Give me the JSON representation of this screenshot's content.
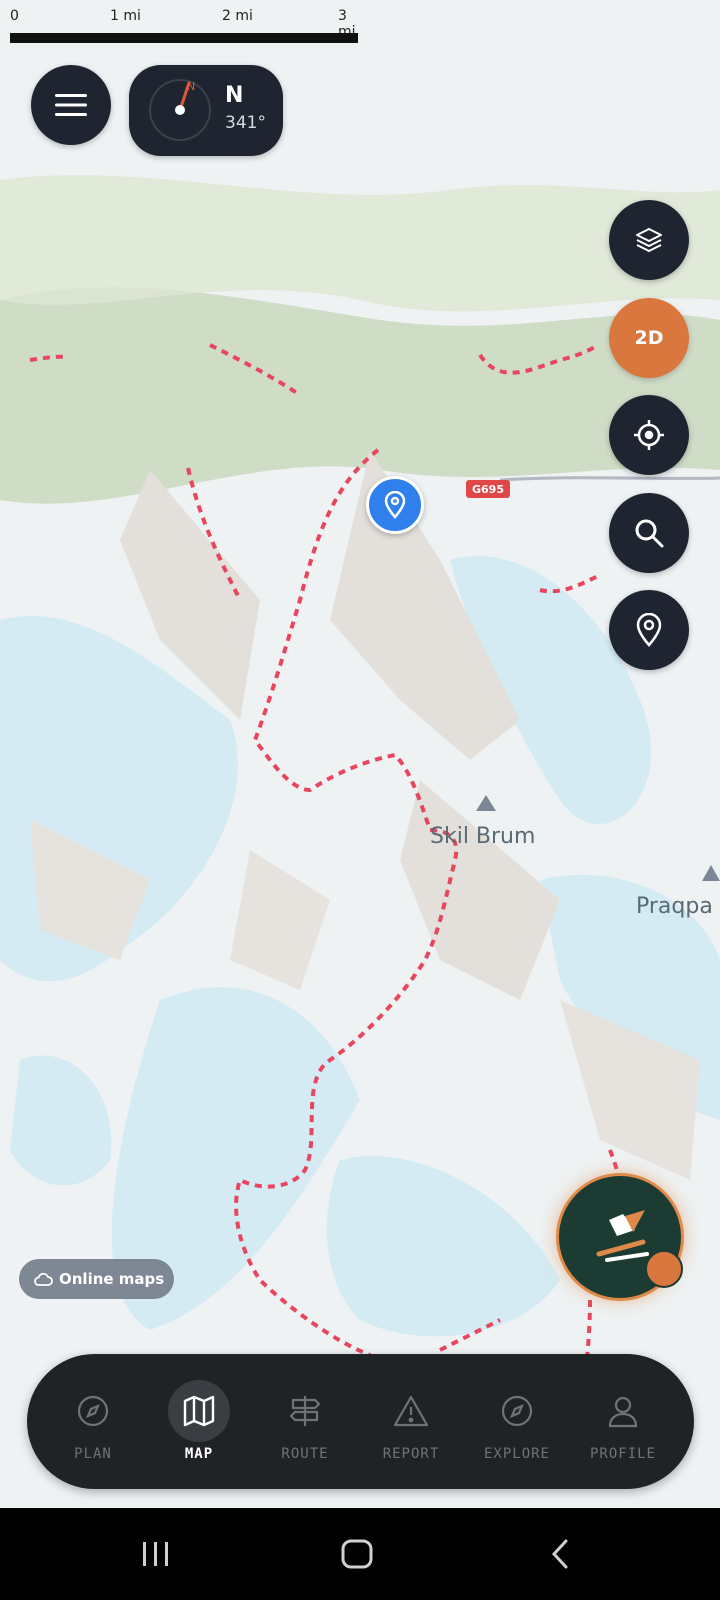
{
  "scale_bar": {
    "labels": [
      "0",
      "1 mi",
      "2 mi",
      "3 mi"
    ]
  },
  "top": {
    "menu_icon": "hamburger-icon",
    "compass": {
      "direction": "N",
      "degrees": "341°"
    }
  },
  "side_controls": {
    "layers_icon": "layers-icon",
    "mode_label": "2D",
    "locate_icon": "crosshair-icon",
    "search_icon": "search-icon",
    "pin_icon": "map-pin-icon"
  },
  "map": {
    "labels": [
      "Skil Brum",
      "Praqpa"
    ],
    "road_badge": "G695",
    "colors": {
      "glacier": "#d4ebf3",
      "forest": "#c9d8bd",
      "trail": "#e8455e",
      "rock": "#e6e3df"
    }
  },
  "online_maps": {
    "label": "Online maps",
    "icon": "cloud-icon"
  },
  "bottom_nav": {
    "items": [
      {
        "label": "PLAN",
        "icon": "compass-icon",
        "active": false
      },
      {
        "label": "MAP",
        "icon": "map-icon",
        "active": true
      },
      {
        "label": "ROUTE",
        "icon": "signpost-icon",
        "active": false
      },
      {
        "label": "REPORT",
        "icon": "warning-icon",
        "active": false
      },
      {
        "label": "EXPLORE",
        "icon": "explore-compass-icon",
        "active": false
      },
      {
        "label": "PROFILE",
        "icon": "profile-icon",
        "active": false
      }
    ]
  },
  "system_nav": {
    "recent": "recent-apps-icon",
    "home": "home-icon",
    "back": "back-icon"
  }
}
